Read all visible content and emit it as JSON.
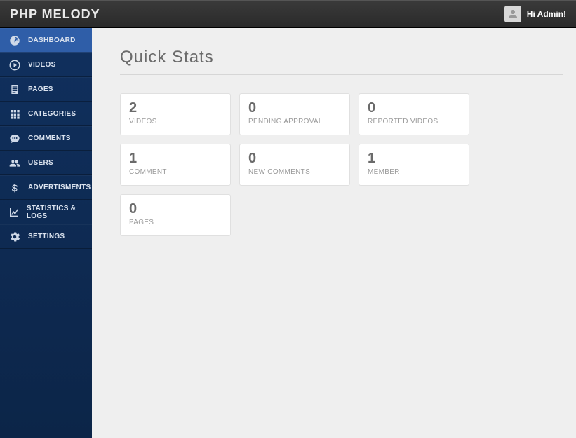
{
  "header": {
    "logo": "PHP MELODY",
    "greeting": "Hi Admin!"
  },
  "sidebar": {
    "items": [
      {
        "label": "DASHBOARD"
      },
      {
        "label": "VIDEOS"
      },
      {
        "label": "PAGES"
      },
      {
        "label": "CATEGORIES"
      },
      {
        "label": "COMMENTS"
      },
      {
        "label": "USERS"
      },
      {
        "label": "ADVERTISMENTS"
      },
      {
        "label": "STATISTICS & LOGS"
      },
      {
        "label": "SETTINGS"
      }
    ]
  },
  "main": {
    "title": "Quick Stats",
    "stats": [
      {
        "value": "2",
        "label": "VIDEOS"
      },
      {
        "value": "0",
        "label": "PENDING APPROVAL"
      },
      {
        "value": "0",
        "label": "REPORTED VIDEOS"
      },
      {
        "value": "1",
        "label": "COMMENT"
      },
      {
        "value": "0",
        "label": "NEW COMMENTS"
      },
      {
        "value": "1",
        "label": "MEMBER"
      },
      {
        "value": "0",
        "label": "PAGES"
      }
    ]
  }
}
